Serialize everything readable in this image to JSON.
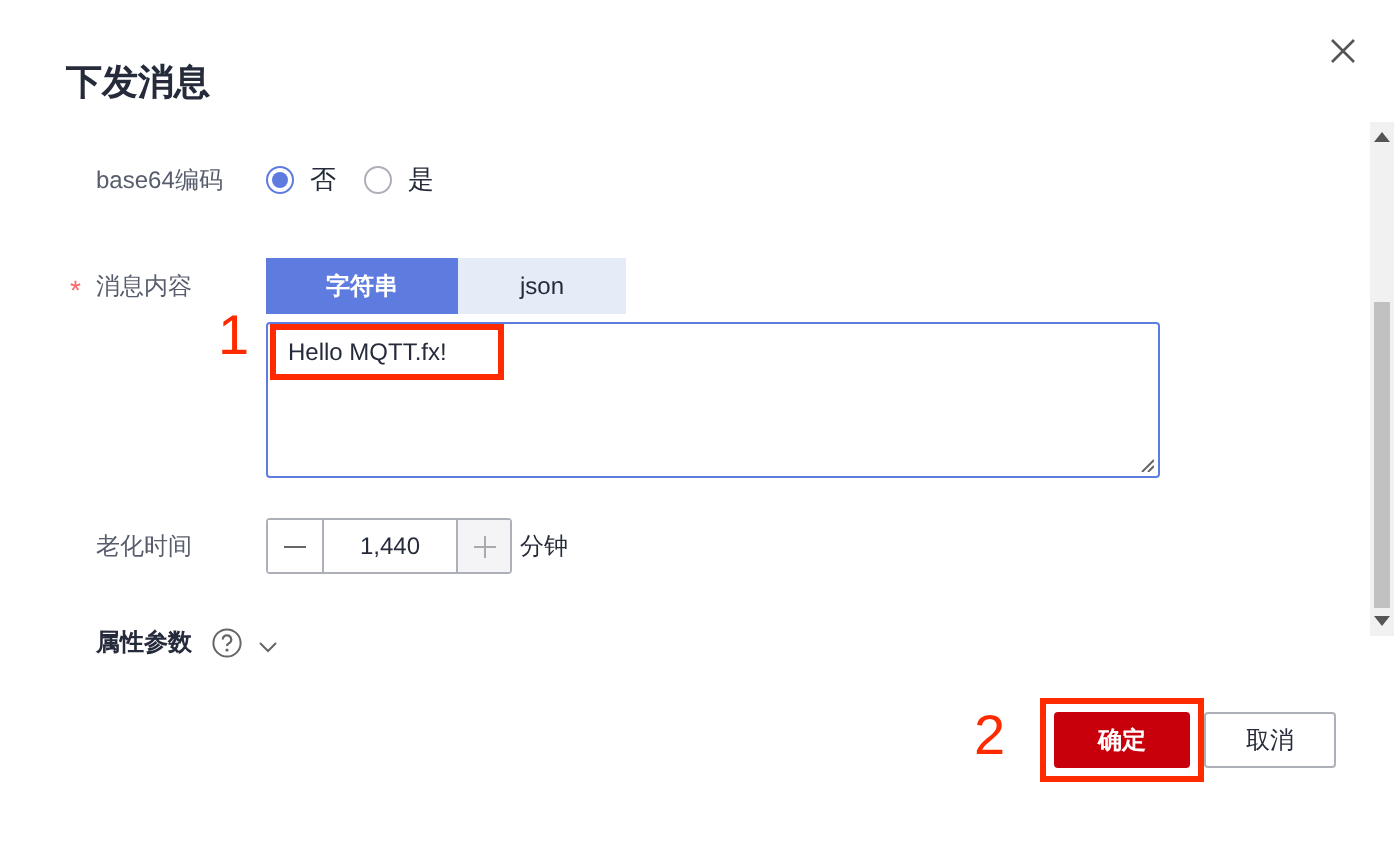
{
  "dialog": {
    "title": "下发消息"
  },
  "form": {
    "encoding": {
      "label": "base64编码",
      "options": [
        {
          "label": "否",
          "selected": true
        },
        {
          "label": "是",
          "selected": false
        }
      ]
    },
    "content": {
      "label": "消息内容",
      "required_mark": "*",
      "tabs": [
        {
          "label": "字符串",
          "selected": true
        },
        {
          "label": "json",
          "selected": false
        }
      ],
      "value": "Hello MQTT.fx!"
    },
    "aging": {
      "label": "老化时间",
      "value": "1,440",
      "unit": "分钟"
    },
    "properties": {
      "label": "属性参数",
      "expanded": false
    }
  },
  "buttons": [
    {
      "label": "确定",
      "kind": "primary"
    },
    {
      "label": "取消",
      "kind": "secondary"
    }
  ],
  "annotations": [
    {
      "label": "1"
    },
    {
      "label": "2"
    }
  ]
}
